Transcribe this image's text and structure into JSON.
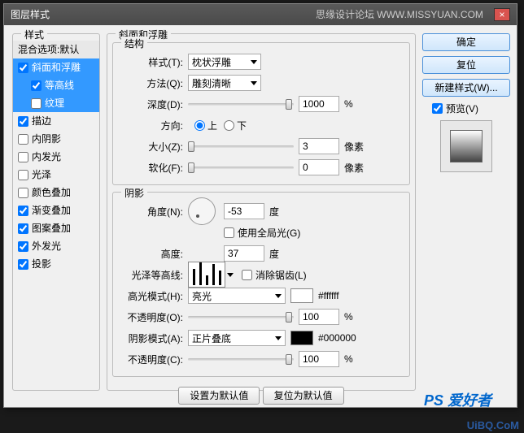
{
  "titlebar": {
    "title": "图层样式",
    "site": "思缘设计论坛 WWW.MISSYUAN.COM"
  },
  "styles": {
    "legend": "样式",
    "blend_defaults": "混合选项:默认",
    "items": [
      {
        "label": "斜面和浮雕",
        "checked": true,
        "selected": true
      },
      {
        "label": "等高线",
        "checked": true,
        "selected": true,
        "indent": true
      },
      {
        "label": "纹理",
        "checked": false,
        "selected": true,
        "indent": true
      },
      {
        "label": "描边",
        "checked": true
      },
      {
        "label": "内阴影",
        "checked": false
      },
      {
        "label": "内发光",
        "checked": false
      },
      {
        "label": "光泽",
        "checked": false
      },
      {
        "label": "颜色叠加",
        "checked": false
      },
      {
        "label": "渐变叠加",
        "checked": true
      },
      {
        "label": "图案叠加",
        "checked": true
      },
      {
        "label": "外发光",
        "checked": true
      },
      {
        "label": "投影",
        "checked": true
      }
    ]
  },
  "main": {
    "legend": "斜面和浮雕",
    "structure": {
      "legend": "结构",
      "style_label": "样式(T):",
      "style_value": "枕状浮雕",
      "technique_label": "方法(Q):",
      "technique_value": "雕刻清晰",
      "depth_label": "深度(D):",
      "depth_value": "1000",
      "depth_unit": "%",
      "direction_label": "方向:",
      "up": "上",
      "down": "下",
      "size_label": "大小(Z):",
      "size_value": "3",
      "size_unit": "像素",
      "soften_label": "软化(F):",
      "soften_value": "0",
      "soften_unit": "像素"
    },
    "shading": {
      "legend": "阴影",
      "angle_label": "角度(N):",
      "angle_value": "-53",
      "angle_unit": "度",
      "global_light": "使用全局光(G)",
      "altitude_label": "高度:",
      "altitude_value": "37",
      "altitude_unit": "度",
      "gloss_label": "光泽等高线:",
      "antialias": "消除锯齿(L)",
      "hmode_label": "高光模式(H):",
      "hmode_value": "亮光",
      "hcolor": "#ffffff",
      "hcolor_text": "#ffffff",
      "hop_label": "不透明度(O):",
      "hop_value": "100",
      "hop_unit": "%",
      "smode_label": "阴影模式(A):",
      "smode_value": "正片叠底",
      "scolor": "#000000",
      "scolor_text": "#000000",
      "sop_label": "不透明度(C):",
      "sop_value": "100",
      "sop_unit": "%"
    },
    "make_default": "设置为默认值",
    "reset_default": "复位为默认值"
  },
  "right": {
    "ok": "确定",
    "cancel": "复位",
    "new_style": "新建样式(W)...",
    "preview": "预览(V)"
  },
  "watermark": {
    "a": "PS 爱好者",
    "b": "UiBQ.CoM"
  }
}
